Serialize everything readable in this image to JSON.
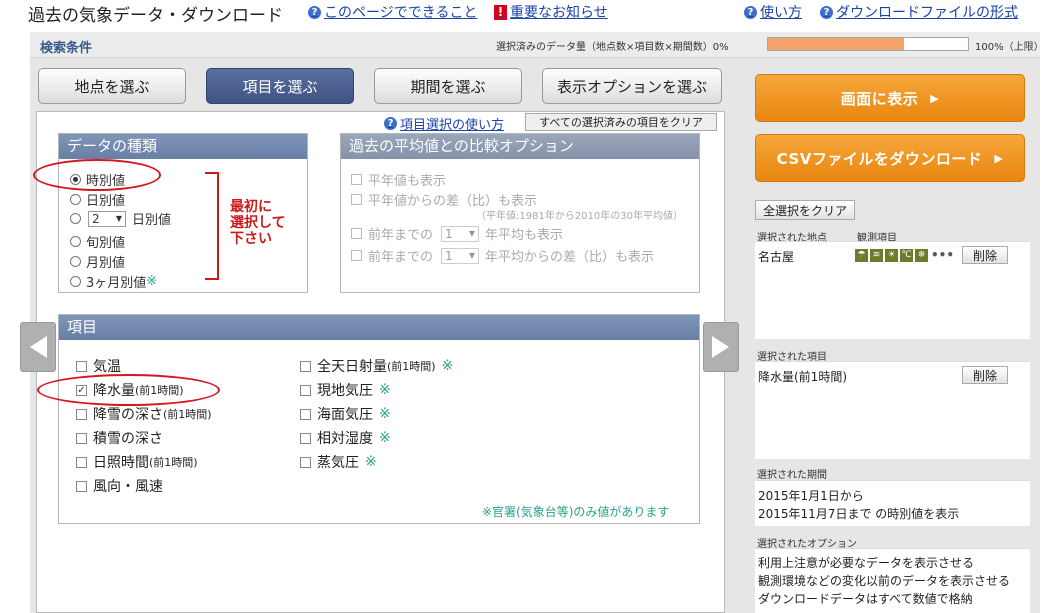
{
  "header": {
    "title": "過去の気象データ・ダウンロード",
    "links": [
      {
        "label": "このページでできること",
        "icon": "question-icon"
      },
      {
        "label": "重要なお知らせ",
        "icon": "exclamation-icon"
      },
      {
        "label": "使い方",
        "icon": "question-icon"
      },
      {
        "label": "ダウンロードファイルの形式",
        "icon": "question-icon"
      }
    ]
  },
  "conditions": {
    "label": "検索条件",
    "amount_text": "選択済みのデータ量（地点数×項目数×期間数）0%",
    "limit_text": "100%（上限）",
    "progress_fraction": 0.68
  },
  "tabs": [
    {
      "label": "地点を選ぶ",
      "active": false
    },
    {
      "label": "項目を選ぶ",
      "active": true
    },
    {
      "label": "期間を選ぶ",
      "active": false
    },
    {
      "label": "表示オプションを選ぶ",
      "active": false
    }
  ],
  "panel": {
    "help_link": "項目選択の使い方",
    "clear_all": "すべての選択済みの項目をクリア"
  },
  "data_type": {
    "title": "データの種類",
    "options": [
      {
        "label": "時別値",
        "selected": true
      },
      {
        "label": "日別値",
        "selected": false
      },
      {
        "label": "日別値",
        "prefix_value": "2",
        "selected": false
      },
      {
        "label": "旬別値",
        "selected": false
      },
      {
        "label": "月別値",
        "selected": false
      },
      {
        "label": "3ヶ月別値",
        "mark": "※",
        "selected": false
      }
    ],
    "annotation": [
      "最初に",
      "選択して",
      "下さい"
    ]
  },
  "comparison": {
    "title": "過去の平均値との比較オプション",
    "opt1": "平年値も表示",
    "opt2": "平年値からの差（比）も表示",
    "opt2_note": "（平年値:1981年から2010年の30年平均値）",
    "opt3_prefix": "前年までの",
    "opt3_value": "1",
    "opt3_suffix": "年平均も表示",
    "opt4_prefix": "前年までの",
    "opt4_value": "1",
    "opt4_suffix": "年平均からの差（比）も表示"
  },
  "items": {
    "title": "項目",
    "left": [
      {
        "label": "気温",
        "small": "",
        "checked": false
      },
      {
        "label": "降水量",
        "small": "(前1時間)",
        "checked": true
      },
      {
        "label": "降雪の深さ",
        "small": "(前1時間)",
        "checked": false
      },
      {
        "label": "積雪の深さ",
        "small": "",
        "checked": false
      },
      {
        "label": "日照時間",
        "small": "(前1時間)",
        "checked": false
      },
      {
        "label": "風向・風速",
        "small": "",
        "checked": false
      }
    ],
    "right": [
      {
        "label": "全天日射量",
        "small": "(前1時間)",
        "mark": "※",
        "checked": false
      },
      {
        "label": "現地気圧",
        "small": "",
        "mark": "※",
        "checked": false
      },
      {
        "label": "海面気圧",
        "small": "",
        "mark": "※",
        "checked": false
      },
      {
        "label": "相対湿度",
        "small": "",
        "mark": "※",
        "checked": false
      },
      {
        "label": "蒸気圧",
        "small": "",
        "mark": "※",
        "checked": false
      }
    ],
    "note": "※官署(気象台等)のみ値があります"
  },
  "actions": {
    "show_screen": "画面に表示",
    "download_csv": "CSVファイルをダウンロード",
    "clear_selection": "全選択をクリア"
  },
  "selected": {
    "station_label": "選択された地点",
    "element_label": "観測項目",
    "station_name": "名古屋",
    "delete_label": "削除",
    "items_label": "選択された項目",
    "item_name": "降水量(前1時間)",
    "period_label": "選択された期間",
    "period_line1": "2015年1月1日から",
    "period_line2": "2015年11月7日まで の時別値を表示",
    "options_label": "選択されたオプション",
    "option_lines": [
      "利用上注意が必要なデータを表示させる",
      "観測環境などの変化以前のデータを表示させる",
      "ダウンロードデータはすべて数値で格納"
    ]
  },
  "colors": {
    "accent_orange": "#ee9220",
    "tab_active": "#4a5f8f",
    "annotation_red": "#d4161f",
    "note_green": "#28a38a"
  }
}
